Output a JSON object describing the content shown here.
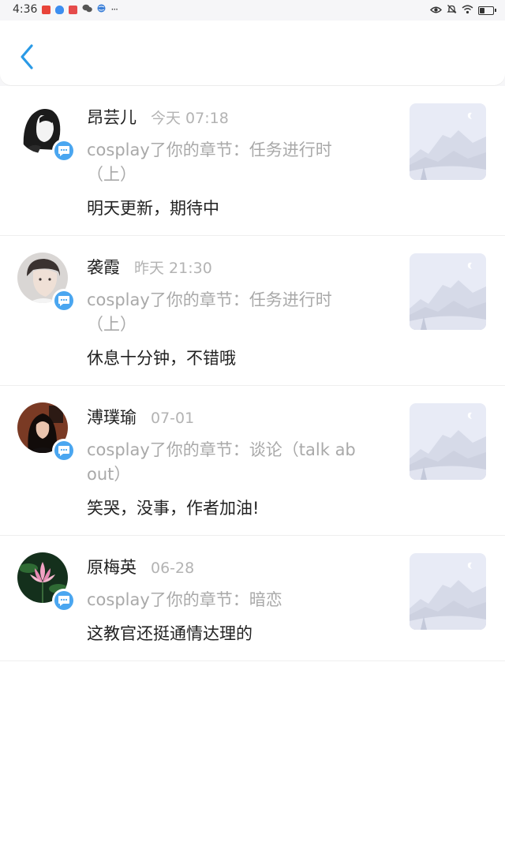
{
  "status_bar": {
    "time": "4:36",
    "more": "···",
    "battery_level": 0.4
  },
  "header": {
    "back_icon": "chevron-left-icon",
    "accent_color": "#2a9ae6"
  },
  "items": [
    {
      "name": "昂芸儿",
      "time": "今天 07:18",
      "chapter": "cosplay了你的章节：任务进行时（上）",
      "comment": "明天更新，期待中"
    },
    {
      "name": "袭霞",
      "time": "昨天 21:30",
      "chapter": "cosplay了你的章节：任务进行时（上）",
      "comment": "休息十分钟，不错哦"
    },
    {
      "name": "溥璞瑜",
      "time": "07-01",
      "chapter": "cosplay了你的章节：谈论（talk about）",
      "comment": "笑哭，没事，作者加油!"
    },
    {
      "name": "原梅英",
      "time": "06-28",
      "chapter": "cosplay了你的章节：暗恋",
      "comment": "这教官还挺通情达理的"
    }
  ],
  "colors": {
    "badge": "#4aa6f0",
    "muted_text": "#a9a9a9",
    "thumb_bg": "#e6e9f4"
  }
}
